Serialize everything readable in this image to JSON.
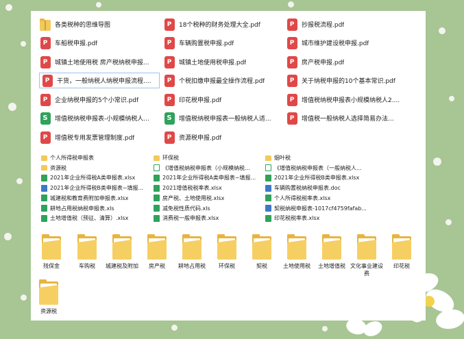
{
  "big_files": [
    {
      "label": "各类税种的思维导图",
      "type": "zip"
    },
    {
      "label": "18个税种的财务处理大全.pdf",
      "type": "pdf"
    },
    {
      "label": "抄报税流程.pdf",
      "type": "pdf"
    },
    {
      "label": "车船税申报.pdf",
      "type": "pdf"
    },
    {
      "label": "车辆购置税申报.pdf",
      "type": "pdf"
    },
    {
      "label": "城市维护建设税申报.pdf",
      "type": "pdf"
    },
    {
      "label": "城镇土地使用税 房产税纳税申报...",
      "type": "pdf"
    },
    {
      "label": "城镇土地使用税申报.pdf",
      "type": "pdf"
    },
    {
      "label": "房产税申报.pdf",
      "type": "pdf"
    },
    {
      "label": "干货，一般纳税人纳税申报流程....",
      "type": "pdf"
    },
    {
      "label": "个税扣缴申报最全操作流程.pdf",
      "type": "pdf"
    },
    {
      "label": "关于纳税申报的10个基本常识.pdf",
      "type": "pdf"
    },
    {
      "label": "企业纳税申报的5个小常识.pdf",
      "type": "pdf"
    },
    {
      "label": "印花税申报.pdf",
      "type": "pdf"
    },
    {
      "label": "增值税纳税申报表小规模纳税人2....",
      "type": "pdf"
    },
    {
      "label": "增值税纳税申报表-小规模纳税人...",
      "type": "xls"
    },
    {
      "label": "增值税纳税申报表一般纳税人适...",
      "type": "xls"
    },
    {
      "label": "增值税一般纳税人选择简易办法...",
      "type": "pdf"
    },
    {
      "label": "增值税专用发票管理制度.pdf",
      "type": "pdf"
    },
    {
      "label": "资源税申报.pdf",
      "type": "pdf"
    }
  ],
  "small_files": [
    {
      "label": "个人所得税申报表",
      "type": "folder"
    },
    {
      "label": "环保税",
      "type": "folder"
    },
    {
      "label": "烟叶税",
      "type": "folder"
    },
    {
      "label": "资源税",
      "type": "folder"
    },
    {
      "label": "《增值税纳税申报表（小规模纳税...",
      "type": "xls-outline"
    },
    {
      "label": "《增值税纳税申报表（一般纳税人...",
      "type": "xls-outline"
    },
    {
      "label": "2021年企业所得税A类申报表.xlsx",
      "type": "xls"
    },
    {
      "label": "2021年企业所得税A类申报表~填报...",
      "type": "xls"
    },
    {
      "label": "2021年企业所得税B类申报表.xlsx",
      "type": "xls"
    },
    {
      "label": "2021年企业所得税B类申报表~填报...",
      "type": "doc"
    },
    {
      "label": "2021增值税税率表.xlsx",
      "type": "xls"
    },
    {
      "label": "车辆购置税纳税申报表.doc",
      "type": "doc"
    },
    {
      "label": "城建税和教育费附加申报表.xlsx",
      "type": "xls"
    },
    {
      "label": "房产税、土地使用税.xlsx",
      "type": "xls"
    },
    {
      "label": "个人所得税税率表.xlsx",
      "type": "xls"
    },
    {
      "label": "耕地占用税纳税申报表.xls",
      "type": "xls"
    },
    {
      "label": "减免税性质代码.xls",
      "type": "xls"
    },
    {
      "label": "契税纳税申报表-1017cf4759fafab...",
      "type": "doc"
    },
    {
      "label": "土地增值税（预征、清算）.xlsx",
      "type": "xls"
    },
    {
      "label": "消费税一般申报表.xlsx",
      "type": "xls"
    },
    {
      "label": "印花税税率表.xlsx",
      "type": "xls"
    }
  ],
  "folders": [
    "残保金",
    "车购税",
    "城建税及附加",
    "房产税",
    "耕地占用税",
    "环保税",
    "契税",
    "土地使用税",
    "土地增值税",
    "文化事业建设费",
    "印花税",
    "资源税"
  ]
}
